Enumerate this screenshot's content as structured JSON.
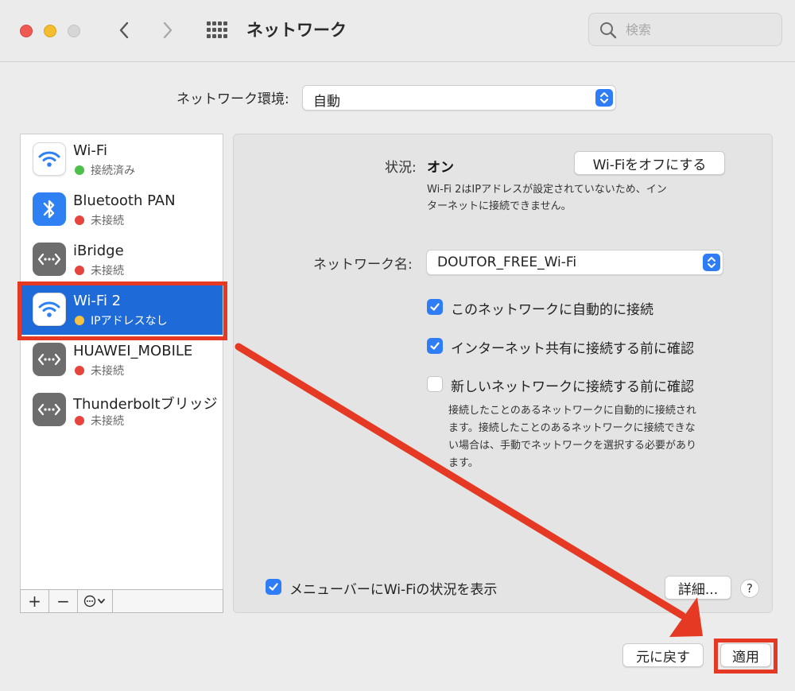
{
  "window": {
    "title": "ネットワーク",
    "search_placeholder": "検索"
  },
  "location": {
    "label": "ネットワーク環境:",
    "value": "自動"
  },
  "services": [
    {
      "name": "Wi-Fi",
      "status": "接続済み",
      "status_color": "#4cc04a",
      "icon": "wifi-icon"
    },
    {
      "name": "Bluetooth PAN",
      "status": "未接続",
      "status_color": "#e5453d",
      "icon": "bluetooth-icon"
    },
    {
      "name": "iBridge",
      "status": "未接続",
      "status_color": "#e5453d",
      "icon": "ethernet-icon"
    },
    {
      "name": "Wi-Fi 2",
      "status": "IPアドレスなし",
      "status_color": "#f6c243",
      "icon": "wifi-icon",
      "selected": true
    },
    {
      "name": "HUAWEI_MOBILE",
      "status": "未接続",
      "status_color": "#e5453d",
      "icon": "ethernet-icon"
    },
    {
      "name": "Thunderboltブリッジ",
      "status": "未接続",
      "status_color": "#e5453d",
      "icon": "ethernet-icon"
    }
  ],
  "sidebar_bar": {
    "add": "+",
    "remove": "−"
  },
  "detail": {
    "status_label": "状況:",
    "status_value": "オン",
    "wifi_off_button": "Wi-Fiをオフにする",
    "status_desc_1": "Wi-Fi 2はIPアドレスが設定されていないため、イン",
    "status_desc_2": "ターネットに接続できません。",
    "network_name_label": "ネットワーク名:",
    "network_name_value": "DOUTOR_FREE_Wi-Fi",
    "checkboxes": [
      {
        "label": "このネットワークに自動的に接続",
        "checked": true
      },
      {
        "label": "インターネット共有に接続する前に確認",
        "checked": true
      },
      {
        "label": "新しいネットワークに接続する前に確認",
        "checked": false
      }
    ],
    "note_1": "接続したことのあるネットワークに自動的に接続され",
    "note_2": "ます。接続したことのあるネットワークに接続できな",
    "note_3": "い場合は、手動でネットワークを選択する必要があり",
    "note_4": "ます。",
    "menubar_label": "メニューバーにWi-Fiの状況を表示",
    "advanced_button": "詳細...",
    "help": "?"
  },
  "footer": {
    "revert_button": "元に戻す",
    "apply_button": "適用"
  },
  "colors": {
    "accent": "#2e7cf6",
    "selection": "#1f6ad9",
    "annotation": "#e53923"
  }
}
